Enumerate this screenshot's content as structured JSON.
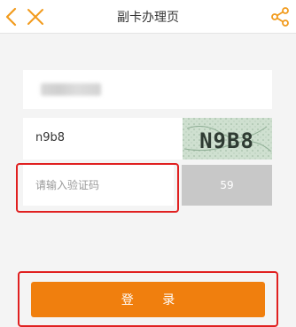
{
  "header": {
    "title": "副卡办理页",
    "back_icon": "chevron-left-icon",
    "close_icon": "close-icon",
    "share_icon": "share-icon",
    "accent_color": "#f29b1d"
  },
  "form": {
    "captcha_input_value": "n9b8",
    "captcha_image_text": "N9B8",
    "code_placeholder": "请输入验证码",
    "countdown_value": "59",
    "login_label": "登 录"
  },
  "colors": {
    "button_orange": "#f07f0e",
    "countdown_gray": "#c8c8c8",
    "highlight_red": "#e02020"
  }
}
